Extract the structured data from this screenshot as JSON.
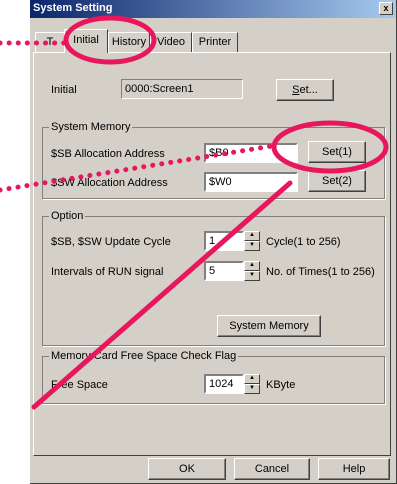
{
  "window": {
    "title": "System Setting",
    "close": "x"
  },
  "tabs": [
    {
      "label": "T"
    },
    {
      "label": "Initial"
    },
    {
      "label": "History"
    },
    {
      "label": "Video"
    },
    {
      "label": "Printer"
    }
  ],
  "initial": {
    "label": "Initial",
    "value": "0000:Screen1",
    "set_button": "Set..."
  },
  "system_memory": {
    "group_label": "System Memory",
    "sb_label": "$SB Allocation Address",
    "sb_value": "$B0",
    "sb_button": "Set(1)",
    "sw_label": "$SW Allocation Address",
    "sw_value": "$W0",
    "sw_button": "Set(2)"
  },
  "option": {
    "group_label": "Option",
    "cycle_label": "$SB, $SW Update Cycle",
    "cycle_value": "1",
    "cycle_unit": "Cycle(1 to 256)",
    "run_label": "Intervals of RUN signal",
    "run_value": "5",
    "run_unit": "No. of Times(1 to 256)",
    "system_memory_button": "System Memory"
  },
  "memory_card": {
    "group_label": "Memory Card Free Space Check Flag",
    "free_label": "Free Space",
    "free_value": "1024",
    "free_unit": "KByte"
  },
  "footer": {
    "ok": "OK",
    "cancel": "Cancel",
    "help": "Help"
  },
  "colors": {
    "highlight": "#e8175d",
    "titlebar": "#0a246a"
  },
  "icons": {
    "spin_up": "triangle-up",
    "spin_down": "triangle-down"
  }
}
